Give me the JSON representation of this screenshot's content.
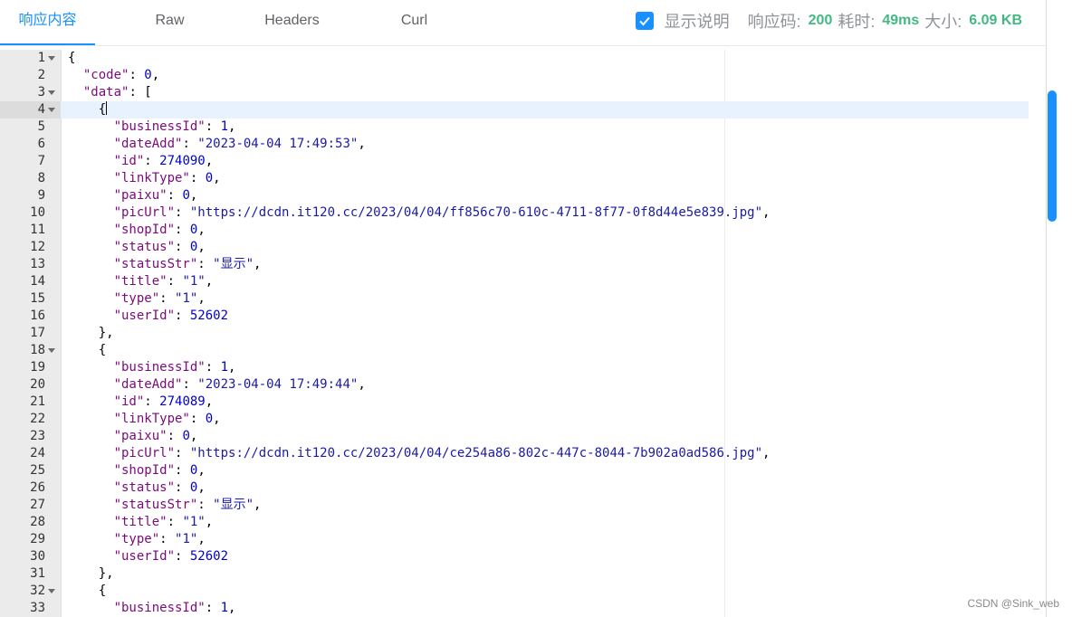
{
  "tabs": [
    {
      "label": "响应内容",
      "active": true
    },
    {
      "label": "Raw",
      "active": false
    },
    {
      "label": "Headers",
      "active": false
    },
    {
      "label": "Curl",
      "active": false
    }
  ],
  "meta": {
    "show_desc_label": "显示说明",
    "show_desc_checked": true,
    "status_label": "响应码:",
    "status_value": "200",
    "time_label": "耗时:",
    "time_value": "49ms",
    "size_label": "大小:",
    "size_value": "6.09 KB"
  },
  "editor": {
    "active_line": 4,
    "lines": [
      {
        "n": 1,
        "fold": true,
        "tokens": [
          [
            "p",
            "{"
          ]
        ]
      },
      {
        "n": 2,
        "tokens": [
          [
            "p",
            "  "
          ],
          [
            "k",
            "\"code\""
          ],
          [
            "p",
            ": "
          ],
          [
            "n",
            "0"
          ],
          [
            "p",
            ","
          ]
        ]
      },
      {
        "n": 3,
        "fold": true,
        "tokens": [
          [
            "p",
            "  "
          ],
          [
            "k",
            "\"data\""
          ],
          [
            "p",
            ": ["
          ]
        ]
      },
      {
        "n": 4,
        "fold": true,
        "cursor": true,
        "tokens": [
          [
            "p",
            "    {"
          ]
        ]
      },
      {
        "n": 5,
        "tokens": [
          [
            "p",
            "      "
          ],
          [
            "k",
            "\"businessId\""
          ],
          [
            "p",
            ": "
          ],
          [
            "n",
            "1"
          ],
          [
            "p",
            ","
          ]
        ]
      },
      {
        "n": 6,
        "tokens": [
          [
            "p",
            "      "
          ],
          [
            "k",
            "\"dateAdd\""
          ],
          [
            "p",
            ": "
          ],
          [
            "s",
            "\"2023-04-04 17:49:53\""
          ],
          [
            "p",
            ","
          ]
        ]
      },
      {
        "n": 7,
        "tokens": [
          [
            "p",
            "      "
          ],
          [
            "k",
            "\"id\""
          ],
          [
            "p",
            ": "
          ],
          [
            "n",
            "274090"
          ],
          [
            "p",
            ","
          ]
        ]
      },
      {
        "n": 8,
        "tokens": [
          [
            "p",
            "      "
          ],
          [
            "k",
            "\"linkType\""
          ],
          [
            "p",
            ": "
          ],
          [
            "n",
            "0"
          ],
          [
            "p",
            ","
          ]
        ]
      },
      {
        "n": 9,
        "tokens": [
          [
            "p",
            "      "
          ],
          [
            "k",
            "\"paixu\""
          ],
          [
            "p",
            ": "
          ],
          [
            "n",
            "0"
          ],
          [
            "p",
            ","
          ]
        ]
      },
      {
        "n": 10,
        "tokens": [
          [
            "p",
            "      "
          ],
          [
            "k",
            "\"picUrl\""
          ],
          [
            "p",
            ": "
          ],
          [
            "s",
            "\"https://dcdn.it120.cc/2023/04/04/ff856c70-610c-4711-8f77-0f8d44e5e839.jpg\""
          ],
          [
            "p",
            ","
          ]
        ]
      },
      {
        "n": 11,
        "tokens": [
          [
            "p",
            "      "
          ],
          [
            "k",
            "\"shopId\""
          ],
          [
            "p",
            ": "
          ],
          [
            "n",
            "0"
          ],
          [
            "p",
            ","
          ]
        ]
      },
      {
        "n": 12,
        "tokens": [
          [
            "p",
            "      "
          ],
          [
            "k",
            "\"status\""
          ],
          [
            "p",
            ": "
          ],
          [
            "n",
            "0"
          ],
          [
            "p",
            ","
          ]
        ]
      },
      {
        "n": 13,
        "tokens": [
          [
            "p",
            "      "
          ],
          [
            "k",
            "\"statusStr\""
          ],
          [
            "p",
            ": "
          ],
          [
            "s",
            "\"显示\""
          ],
          [
            "p",
            ","
          ]
        ]
      },
      {
        "n": 14,
        "tokens": [
          [
            "p",
            "      "
          ],
          [
            "k",
            "\"title\""
          ],
          [
            "p",
            ": "
          ],
          [
            "s",
            "\"1\""
          ],
          [
            "p",
            ","
          ]
        ]
      },
      {
        "n": 15,
        "tokens": [
          [
            "p",
            "      "
          ],
          [
            "k",
            "\"type\""
          ],
          [
            "p",
            ": "
          ],
          [
            "s",
            "\"1\""
          ],
          [
            "p",
            ","
          ]
        ]
      },
      {
        "n": 16,
        "tokens": [
          [
            "p",
            "      "
          ],
          [
            "k",
            "\"userId\""
          ],
          [
            "p",
            ": "
          ],
          [
            "n",
            "52602"
          ]
        ]
      },
      {
        "n": 17,
        "tokens": [
          [
            "p",
            "    },"
          ]
        ]
      },
      {
        "n": 18,
        "fold": true,
        "tokens": [
          [
            "p",
            "    {"
          ]
        ]
      },
      {
        "n": 19,
        "tokens": [
          [
            "p",
            "      "
          ],
          [
            "k",
            "\"businessId\""
          ],
          [
            "p",
            ": "
          ],
          [
            "n",
            "1"
          ],
          [
            "p",
            ","
          ]
        ]
      },
      {
        "n": 20,
        "tokens": [
          [
            "p",
            "      "
          ],
          [
            "k",
            "\"dateAdd\""
          ],
          [
            "p",
            ": "
          ],
          [
            "s",
            "\"2023-04-04 17:49:44\""
          ],
          [
            "p",
            ","
          ]
        ]
      },
      {
        "n": 21,
        "tokens": [
          [
            "p",
            "      "
          ],
          [
            "k",
            "\"id\""
          ],
          [
            "p",
            ": "
          ],
          [
            "n",
            "274089"
          ],
          [
            "p",
            ","
          ]
        ]
      },
      {
        "n": 22,
        "tokens": [
          [
            "p",
            "      "
          ],
          [
            "k",
            "\"linkType\""
          ],
          [
            "p",
            ": "
          ],
          [
            "n",
            "0"
          ],
          [
            "p",
            ","
          ]
        ]
      },
      {
        "n": 23,
        "tokens": [
          [
            "p",
            "      "
          ],
          [
            "k",
            "\"paixu\""
          ],
          [
            "p",
            ": "
          ],
          [
            "n",
            "0"
          ],
          [
            "p",
            ","
          ]
        ]
      },
      {
        "n": 24,
        "tokens": [
          [
            "p",
            "      "
          ],
          [
            "k",
            "\"picUrl\""
          ],
          [
            "p",
            ": "
          ],
          [
            "s",
            "\"https://dcdn.it120.cc/2023/04/04/ce254a86-802c-447c-8044-7b902a0ad586.jpg\""
          ],
          [
            "p",
            ","
          ]
        ]
      },
      {
        "n": 25,
        "tokens": [
          [
            "p",
            "      "
          ],
          [
            "k",
            "\"shopId\""
          ],
          [
            "p",
            ": "
          ],
          [
            "n",
            "0"
          ],
          [
            "p",
            ","
          ]
        ]
      },
      {
        "n": 26,
        "tokens": [
          [
            "p",
            "      "
          ],
          [
            "k",
            "\"status\""
          ],
          [
            "p",
            ": "
          ],
          [
            "n",
            "0"
          ],
          [
            "p",
            ","
          ]
        ]
      },
      {
        "n": 27,
        "tokens": [
          [
            "p",
            "      "
          ],
          [
            "k",
            "\"statusStr\""
          ],
          [
            "p",
            ": "
          ],
          [
            "s",
            "\"显示\""
          ],
          [
            "p",
            ","
          ]
        ]
      },
      {
        "n": 28,
        "tokens": [
          [
            "p",
            "      "
          ],
          [
            "k",
            "\"title\""
          ],
          [
            "p",
            ": "
          ],
          [
            "s",
            "\"1\""
          ],
          [
            "p",
            ","
          ]
        ]
      },
      {
        "n": 29,
        "tokens": [
          [
            "p",
            "      "
          ],
          [
            "k",
            "\"type\""
          ],
          [
            "p",
            ": "
          ],
          [
            "s",
            "\"1\""
          ],
          [
            "p",
            ","
          ]
        ]
      },
      {
        "n": 30,
        "tokens": [
          [
            "p",
            "      "
          ],
          [
            "k",
            "\"userId\""
          ],
          [
            "p",
            ": "
          ],
          [
            "n",
            "52602"
          ]
        ]
      },
      {
        "n": 31,
        "tokens": [
          [
            "p",
            "    },"
          ]
        ]
      },
      {
        "n": 32,
        "fold": true,
        "tokens": [
          [
            "p",
            "    {"
          ]
        ]
      },
      {
        "n": 33,
        "tokens": [
          [
            "p",
            "      "
          ],
          [
            "k",
            "\"businessId\""
          ],
          [
            "p",
            ": "
          ],
          [
            "n",
            "1"
          ],
          [
            "p",
            ","
          ]
        ]
      }
    ]
  },
  "watermark": "CSDN @Sink_web"
}
